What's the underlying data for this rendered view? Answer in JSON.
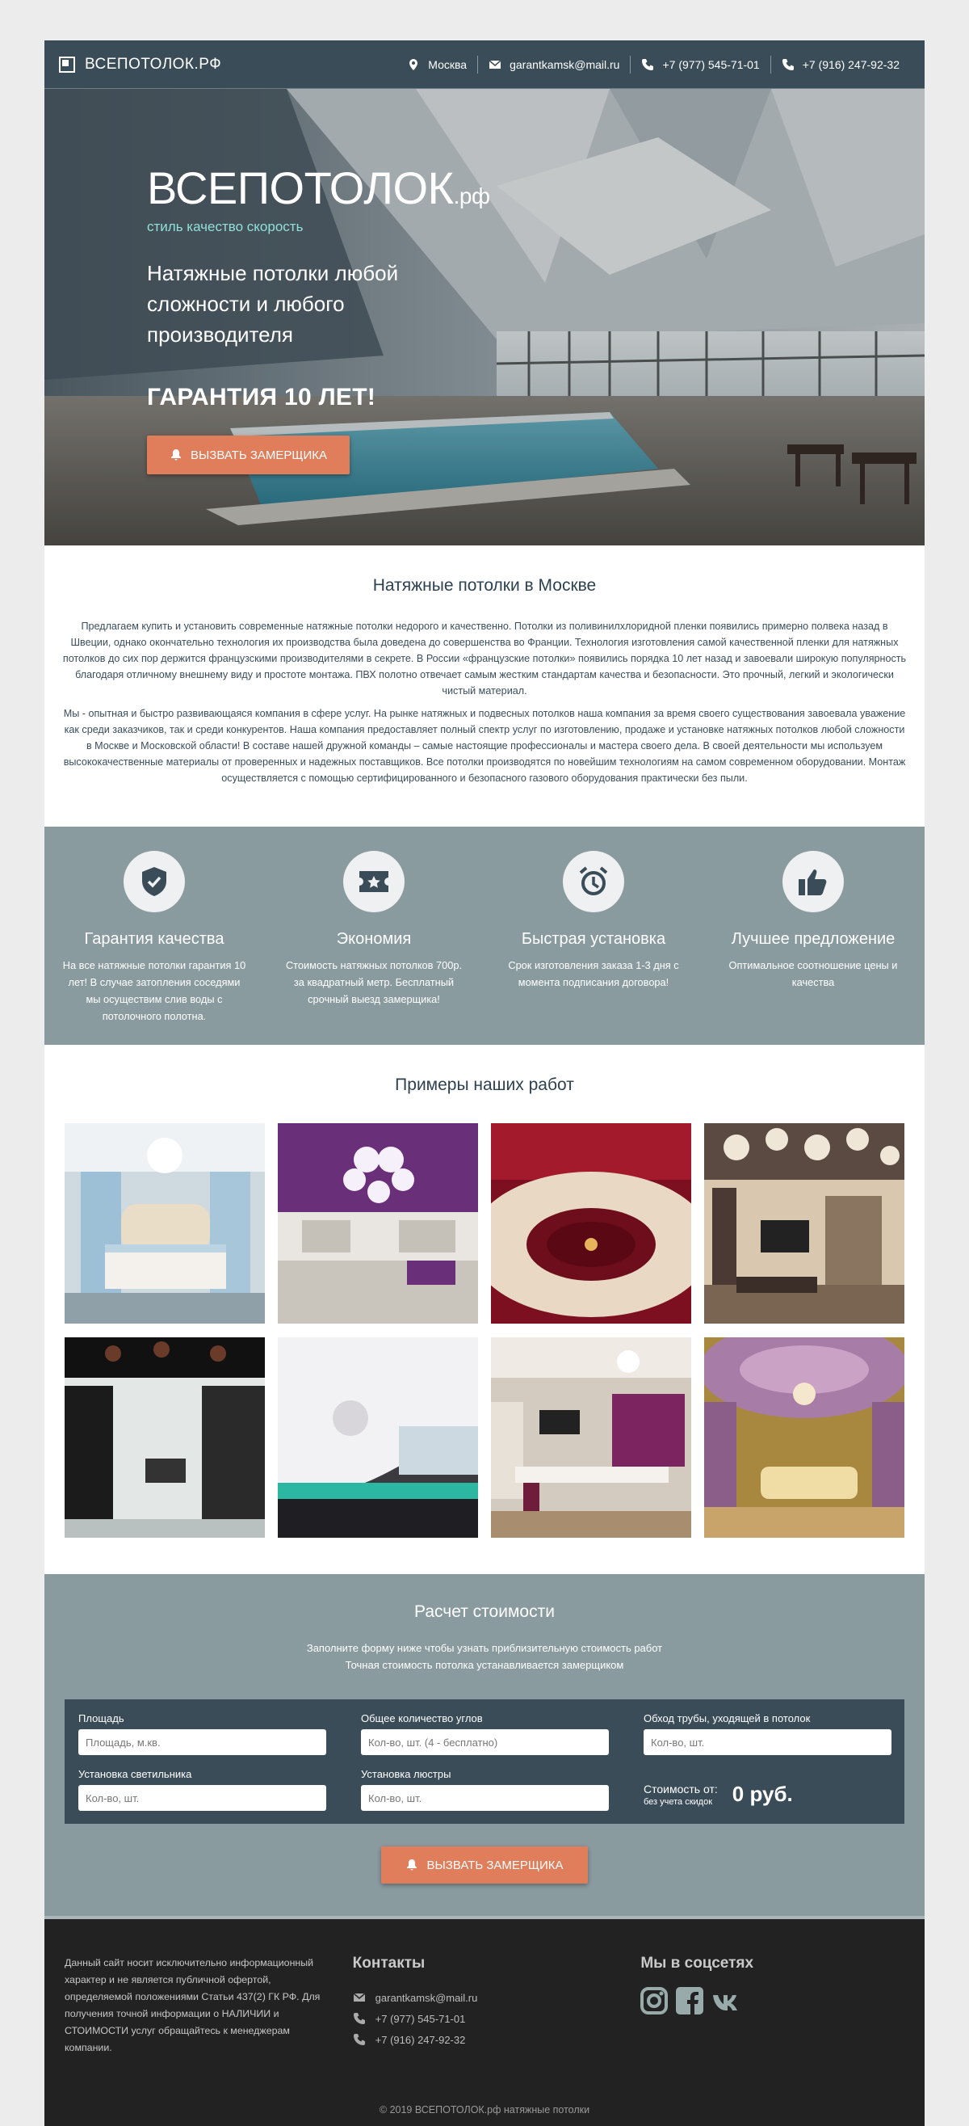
{
  "header": {
    "logo_text": "ВСЕПОТОЛОК.РФ",
    "city": "Москва",
    "email": "garantkamsk@mail.ru",
    "phone1": "+7 (977) 545-71-01",
    "phone2": "+7 (916) 247-92-32"
  },
  "hero": {
    "brand_main": "ВСЕПОТОЛОК",
    "brand_suffix": ".рф",
    "slogan": "стиль качество скорость",
    "subtitle": "Натяжные потолки любой сложности и любого производителя",
    "guarantee": "ГАРАНТИЯ 10 ЛЕТ!",
    "cta_label": "ВЫЗВАТЬ ЗАМЕРЩИКА"
  },
  "about": {
    "title": "Натяжные потолки в Москве",
    "p1": "Предлагаем купить и установить современные натяжные потолки недорого и качественно. Потолки из поливинилхлоридной пленки появились примерно полвека назад в Швеции, однако окончательно технология их производства была доведена до совершенства во Франции. Технология изготовления самой качественной пленки для натяжных потолков до сих пор держится французскими производителями в секрете. В России «французские потолки» появились порядка 10 лет назад и завоевали широкую популярность благодаря отличному внешнему виду и простоте монтажа. ПВХ полотно отвечает самым жестким стандартам качества и безопасности. Это прочный, легкий и экологически чистый материал.",
    "p2": "Мы - опытная и быстро развивающаяся компания в сфере услуг. На рынке натяжных и подвесных потолков наша компания за время своего существования завоевала уважение как среди заказчиков, так и среди конкурентов. Наша компания предоставляет полный спектр услуг по изготовлению, продаже и установке натяжных потолков любой сложности в Москве и Московской области! В составе нашей дружной команды – самые настоящие профессионалы и мастера своего дела. В своей деятельности мы используем высококачественные материалы от проверенных и надежных поставщиков. Все потолки производятся по новейшим технологиям на самом современном оборудовании. Монтаж осуществляется с помощью сертифицированного и безопасного газового оборудования практически без пыли."
  },
  "features": [
    {
      "icon": "shield-check-icon",
      "title": "Гарантия качества",
      "text": "На все натяжные потолки гарантия 10 лет! В случае затопления соседями мы осуществим слив воды с потолочного полотна."
    },
    {
      "icon": "ticket-star-icon",
      "title": "Экономия",
      "text": "Стоимость натяжных потолков 700р. за квадратный метр. Бесплатный срочный выезд замерщика!"
    },
    {
      "icon": "alarm-clock-icon",
      "title": "Быстрая установка",
      "text": "Срок изготовления заказа 1-3 дня с момента подписания договора!"
    },
    {
      "icon": "thumbs-up-icon",
      "title": "Лучшее предложение",
      "text": "Оптимальное соотношение цены и качества"
    }
  ],
  "works": {
    "title": "Примеры наших работ"
  },
  "calc": {
    "title": "Расчет стоимости",
    "hint1": "Заполните форму ниже чтобы узнать приблизительную стоимость работ",
    "hint2": "Точная стоимость потолка устанавливается замерщиком",
    "area_label": "Площадь",
    "area_placeholder": "Площадь, м.кв.",
    "corners_label": "Общее количество углов",
    "corners_placeholder": "Кол-во, шт. (4 - бесплатно)",
    "pipe_label": "Обход трубы, уходящей в потолок",
    "pipe_placeholder": "Кол-во, шт.",
    "lamp_label": "Установка светильника",
    "lamp_placeholder": "Кол-во, шт.",
    "chandelier_label": "Установка люстры",
    "chandelier_placeholder": "Кол-во, шт.",
    "price_label": "Стоимость от:",
    "price_note": "без учета скидок",
    "price_value": "0 руб.",
    "cta_label": "ВЫЗВАТЬ ЗАМЕРЩИКА"
  },
  "footer": {
    "disclaimer": "Данный сайт носит исключительно информационный характер и не является публичной офертой, определяемой положениями Статьи 437(2) ГК РФ. Для получения точной информации о НАЛИЧИИ и СТОИМОСТИ услуг обращайтесь к менеджерам компании.",
    "contacts_title": "Контакты",
    "email": "garantkamsk@mail.ru",
    "phone1": "+7 (977) 545-71-01",
    "phone2": "+7 (916) 247-92-32",
    "social_title": "Мы в соцсетях",
    "copyright": "© 2019 ВСЕПОТОЛОК.рф натяжные потолки"
  },
  "colors": {
    "header_bg": "#3a4c58",
    "accent": "#e07e5b",
    "section_bg": "#8a9ba0",
    "footer_bg": "#222222",
    "slogan": "#8fe0d8"
  }
}
